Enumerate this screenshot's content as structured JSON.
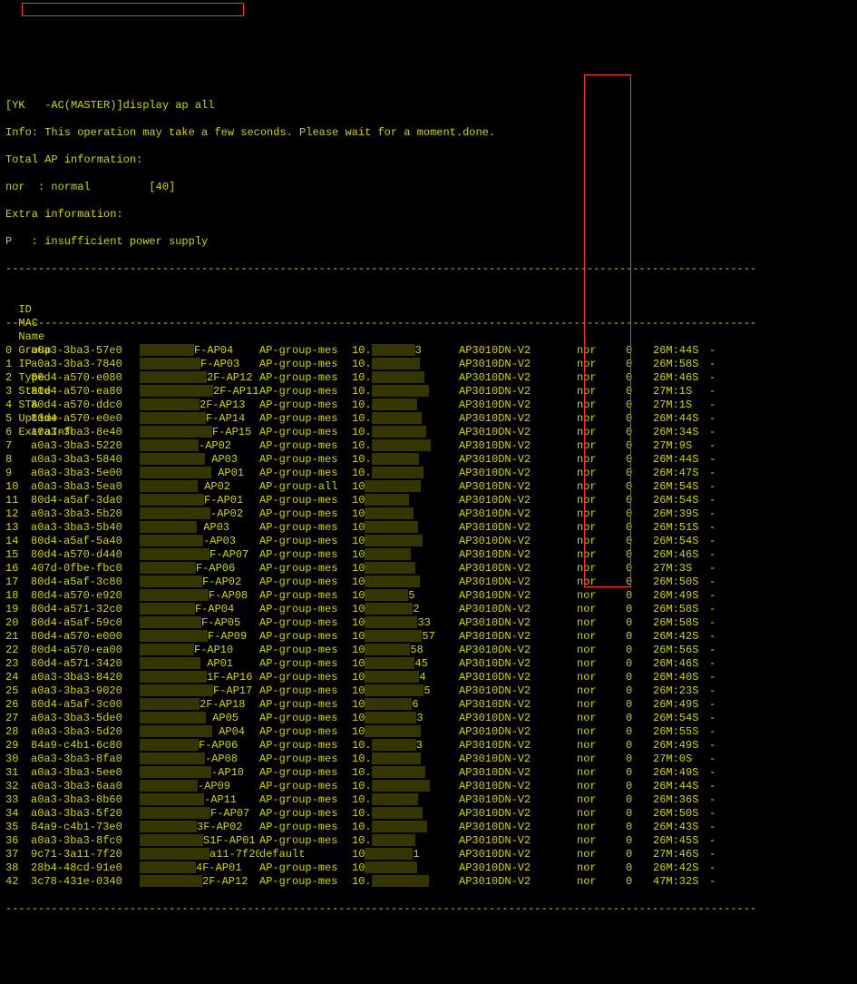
{
  "prompt_text": "[YK   -AC(MASTER)]display ap all",
  "info_line": "Info: This operation may take a few seconds. Please wait for a moment.done.",
  "total_line": "Total AP information:",
  "nor_line": "nor  : normal         [40]",
  "extra_line": "Extra information:",
  "p_line": "P   : insufficient power supply",
  "dashes": "-------------------------------------------------------------------------------------------------------------------",
  "headers": {
    "id": "ID",
    "mac": "MAC",
    "name": "Name",
    "group": "Group",
    "ip": "IP",
    "type": "Type",
    "state": "State",
    "sta": "STA",
    "uptime": "Uptime",
    "extra": "ExtraInfo"
  },
  "rows": [
    {
      "id": "0",
      "mac": "a0a3-3ba3-57e0",
      "name": "F-AP04",
      "group": "AP-group-mes",
      "ip": "10.",
      "ipr": "3",
      "type": "AP3010DN-V2",
      "state": "nor",
      "sta": "0",
      "uptime": "26M:44S",
      "extra": "-"
    },
    {
      "id": "1",
      "mac": "a0a3-3ba3-7840",
      "name": "F-AP03",
      "group": "AP-group-mes",
      "ip": "10.",
      "ipr": "",
      "type": "AP3010DN-V2",
      "state": "nor",
      "sta": "0",
      "uptime": "26M:58S",
      "extra": "-"
    },
    {
      "id": "2",
      "mac": "80d4-a570-e080",
      "name": "2F-AP12",
      "group": "AP-group-mes",
      "ip": "10.",
      "ipr": "",
      "type": "AP3010DN-V2",
      "state": "nor",
      "sta": "0",
      "uptime": "26M:46S",
      "extra": "-"
    },
    {
      "id": "3",
      "mac": "80d4-a570-ea80",
      "name": "2F-AP11",
      "group": "AP-group-mes",
      "ip": "10.",
      "ipr": "",
      "type": "AP3010DN-V2",
      "state": "nor",
      "sta": "0",
      "uptime": "27M:1S",
      "extra": "-"
    },
    {
      "id": "4",
      "mac": "80d4-a570-ddc0",
      "name": "2F-AP13",
      "group": "AP-group-mes",
      "ip": "10.",
      "ipr": "",
      "type": "AP3010DN-V2",
      "state": "nor",
      "sta": "0",
      "uptime": "27M:1S",
      "extra": "-"
    },
    {
      "id": "5",
      "mac": "80d4-a570-e0e0",
      "name": "F-AP14",
      "group": "AP-group-mes",
      "ip": "10.",
      "ipr": "",
      "type": "AP3010DN-V2",
      "state": "nor",
      "sta": "0",
      "uptime": "26M:44S",
      "extra": "-"
    },
    {
      "id": "6",
      "mac": "a0a3-3ba3-8e40",
      "name": "F-AP15",
      "group": "AP-group-mes",
      "ip": "10.",
      "ipr": "",
      "type": "AP3010DN-V2",
      "state": "nor",
      "sta": "0",
      "uptime": "26M:34S",
      "extra": "-"
    },
    {
      "id": "7",
      "mac": "a0a3-3ba3-5220",
      "name": "-AP02",
      "group": "AP-group-mes",
      "ip": "10.",
      "ipr": "",
      "type": "AP3010DN-V2",
      "state": "nor",
      "sta": "0",
      "uptime": "27M:9S",
      "extra": "-"
    },
    {
      "id": "8",
      "mac": "a0a3-3ba3-5840",
      "name": " AP03",
      "group": "AP-group-mes",
      "ip": "10.",
      "ipr": "",
      "type": "AP3010DN-V2",
      "state": "nor",
      "sta": "0",
      "uptime": "26M:44S",
      "extra": "-"
    },
    {
      "id": "9",
      "mac": "a0a3-3ba3-5e00",
      "name": " AP01",
      "group": "AP-group-mes",
      "ip": "10.",
      "ipr": "",
      "type": "AP3010DN-V2",
      "state": "nor",
      "sta": "0",
      "uptime": "26M:47S",
      "extra": "-"
    },
    {
      "id": "10",
      "mac": "a0a3-3ba3-5ea0",
      "name": " AP02",
      "group": "AP-group-all",
      "ip": "10",
      "ipr": "",
      "type": "AP3010DN-V2",
      "state": "nor",
      "sta": "0",
      "uptime": "26M:54S",
      "extra": "-"
    },
    {
      "id": "11",
      "mac": "80d4-a5af-3da0",
      "name": "F-AP01",
      "group": "AP-group-mes",
      "ip": "10",
      "ipr": "",
      "type": "AP3010DN-V2",
      "state": "nor",
      "sta": "0",
      "uptime": "26M:54S",
      "extra": "-"
    },
    {
      "id": "12",
      "mac": "a0a3-3ba3-5b20",
      "name": "-AP02",
      "group": "AP-group-mes",
      "ip": "10",
      "ipr": "",
      "type": "AP3010DN-V2",
      "state": "nor",
      "sta": "0",
      "uptime": "26M:39S",
      "extra": "-"
    },
    {
      "id": "13",
      "mac": "a0a3-3ba3-5b40",
      "name": " AP03",
      "group": "AP-group-mes",
      "ip": "10",
      "ipr": "",
      "type": "AP3010DN-V2",
      "state": "nor",
      "sta": "0",
      "uptime": "26M:51S",
      "extra": "-"
    },
    {
      "id": "14",
      "mac": "80d4-a5af-5a40",
      "name": "-AP03",
      "group": "AP-group-mes",
      "ip": "10",
      "ipr": "",
      "type": "AP3010DN-V2",
      "state": "nor",
      "sta": "0",
      "uptime": "26M:54S",
      "extra": "-"
    },
    {
      "id": "15",
      "mac": "80d4-a570-d440",
      "name": "F-AP07",
      "group": "AP-group-mes",
      "ip": "10",
      "ipr": "",
      "type": "AP3010DN-V2",
      "state": "nor",
      "sta": "0",
      "uptime": "26M:46S",
      "extra": "-"
    },
    {
      "id": "16",
      "mac": "407d-0fbe-fbc0",
      "name": "F-AP06",
      "group": "AP-group-mes",
      "ip": "10",
      "ipr": "",
      "type": "AP3010DN-V2",
      "state": "nor",
      "sta": "0",
      "uptime": "27M:3S",
      "extra": "-"
    },
    {
      "id": "17",
      "mac": "80d4-a5af-3c80",
      "name": "F-AP02",
      "group": "AP-group-mes",
      "ip": "10",
      "ipr": "",
      "type": "AP3010DN-V2",
      "state": "nor",
      "sta": "0",
      "uptime": "26M:50S",
      "extra": "-"
    },
    {
      "id": "18",
      "mac": "80d4-a570-e920",
      "name": "F-AP08",
      "group": "AP-group-mes",
      "ip": "10",
      "ipr": "5",
      "type": "AP3010DN-V2",
      "state": "nor",
      "sta": "0",
      "uptime": "26M:49S",
      "extra": "-"
    },
    {
      "id": "19",
      "mac": "80d4-a571-32c0",
      "name": "F-AP04",
      "group": "AP-group-mes",
      "ip": "10",
      "ipr": "2",
      "type": "AP3010DN-V2",
      "state": "nor",
      "sta": "0",
      "uptime": "26M:58S",
      "extra": "-"
    },
    {
      "id": "20",
      "mac": "80d4-a5af-59c0",
      "name": "F-AP05",
      "group": "AP-group-mes",
      "ip": "10",
      "ipr": "33",
      "type": "AP3010DN-V2",
      "state": "nor",
      "sta": "0",
      "uptime": "26M:58S",
      "extra": "-"
    },
    {
      "id": "21",
      "mac": "80d4-a570-e000",
      "name": "F-AP09",
      "group": "AP-group-mes",
      "ip": "10",
      "ipr": "57",
      "type": "AP3010DN-V2",
      "state": "nor",
      "sta": "0",
      "uptime": "26M:42S",
      "extra": "-"
    },
    {
      "id": "22",
      "mac": "80d4-a570-ea00",
      "name": "F-AP10",
      "group": "AP-group-mes",
      "ip": "10",
      "ipr": "58",
      "type": "AP3010DN-V2",
      "state": "nor",
      "sta": "0",
      "uptime": "26M:56S",
      "extra": "-"
    },
    {
      "id": "23",
      "mac": "80d4-a571-3420",
      "name": " AP01",
      "group": "AP-group-mes",
      "ip": "10",
      "ipr": "45",
      "type": "AP3010DN-V2",
      "state": "nor",
      "sta": "0",
      "uptime": "26M:46S",
      "extra": "-"
    },
    {
      "id": "24",
      "mac": "a0a3-3ba3-8420",
      "name": "1F-AP16",
      "group": "AP-group-mes",
      "ip": "10",
      "ipr": "4",
      "type": "AP3010DN-V2",
      "state": "nor",
      "sta": "0",
      "uptime": "26M:40S",
      "extra": "-"
    },
    {
      "id": "25",
      "mac": "a0a3-3ba3-9020",
      "name": "F-AP17",
      "group": "AP-group-mes",
      "ip": "10",
      "ipr": "5",
      "type": "AP3010DN-V2",
      "state": "nor",
      "sta": "0",
      "uptime": "26M:23S",
      "extra": "-"
    },
    {
      "id": "26",
      "mac": "80d4-a5af-3c00",
      "name": "2F-AP18",
      "group": "AP-group-mes",
      "ip": "10",
      "ipr": "6",
      "type": "AP3010DN-V2",
      "state": "nor",
      "sta": "0",
      "uptime": "26M:49S",
      "extra": "-"
    },
    {
      "id": "27",
      "mac": "a0a3-3ba3-5de0",
      "name": " AP05",
      "group": "AP-group-mes",
      "ip": "10",
      "ipr": "3",
      "type": "AP3010DN-V2",
      "state": "nor",
      "sta": "0",
      "uptime": "26M:54S",
      "extra": "-"
    },
    {
      "id": "28",
      "mac": "a0a3-3ba3-5d20",
      "name": " AP04",
      "group": "AP-group-mes",
      "ip": "10",
      "ipr": "",
      "type": "AP3010DN-V2",
      "state": "nor",
      "sta": "0",
      "uptime": "26M:55S",
      "extra": "-"
    },
    {
      "id": "29",
      "mac": "84a9-c4b1-6c80",
      "name": "F-AP06",
      "group": "AP-group-mes",
      "ip": "10.",
      "ipr": "3",
      "type": "AP3010DN-V2",
      "state": "nor",
      "sta": "0",
      "uptime": "26M:49S",
      "extra": "-"
    },
    {
      "id": "30",
      "mac": "a0a3-3ba3-8fa0",
      "name": "-AP08",
      "group": "AP-group-mes",
      "ip": "10.",
      "ipr": "",
      "type": "AP3010DN-V2",
      "state": "nor",
      "sta": "0",
      "uptime": "27M:0S",
      "extra": "-"
    },
    {
      "id": "31",
      "mac": "a0a3-3ba3-5ee0",
      "name": "-AP10",
      "group": "AP-group-mes",
      "ip": "10.",
      "ipr": "",
      "type": "AP3010DN-V2",
      "state": "nor",
      "sta": "0",
      "uptime": "26M:49S",
      "extra": "-"
    },
    {
      "id": "32",
      "mac": "a0a3-3ba3-6aa0",
      "name": "-AP09",
      "group": "AP-group-mes",
      "ip": "10.",
      "ipr": "",
      "type": "AP3010DN-V2",
      "state": "nor",
      "sta": "0",
      "uptime": "26M:44S",
      "extra": "-"
    },
    {
      "id": "33",
      "mac": "a0a3-3ba3-8b60",
      "name": "-AP11",
      "group": "AP-group-mes",
      "ip": "10.",
      "ipr": "",
      "type": "AP3010DN-V2",
      "state": "nor",
      "sta": "0",
      "uptime": "26M:36S",
      "extra": "-"
    },
    {
      "id": "34",
      "mac": "a0a3-3ba3-5f20",
      "name": "F-AP07",
      "group": "AP-group-mes",
      "ip": "10.",
      "ipr": "",
      "type": "AP3010DN-V2",
      "state": "nor",
      "sta": "0",
      "uptime": "26M:50S",
      "extra": "-"
    },
    {
      "id": "35",
      "mac": "84a9-c4b1-73e0",
      "name": "3F-AP02",
      "group": "AP-group-mes",
      "ip": "10.",
      "ipr": "",
      "type": "AP3010DN-V2",
      "state": "nor",
      "sta": "0",
      "uptime": "26M:43S",
      "extra": "-"
    },
    {
      "id": "36",
      "mac": "a0a3-3ba3-8fc0",
      "name": "S1F-AP01",
      "group": "AP-group-mes",
      "ip": "10.",
      "ipr": "",
      "type": "AP3010DN-V2",
      "state": "nor",
      "sta": "0",
      "uptime": "26M:45S",
      "extra": "-"
    },
    {
      "id": "37",
      "mac": "9c71-3a11-7f20",
      "name": "a11-7f20",
      "group": "default",
      "ip": "10",
      "ipr": "1",
      "type": "AP3010DN-V2",
      "state": "nor",
      "sta": "0",
      "uptime": "27M:46S",
      "extra": "-"
    },
    {
      "id": "38",
      "mac": "28b4-48cd-91e0",
      "name": "4F-AP01",
      "group": "AP-group-mes",
      "ip": "10",
      "ipr": "",
      "type": "AP3010DN-V2",
      "state": "nor",
      "sta": "0",
      "uptime": "26M:42S",
      "extra": "-"
    },
    {
      "id": "42",
      "mac": "3c78-431e-0340",
      "name": "2F-AP12",
      "group": "AP-group-mes",
      "ip": "10.",
      "ipr": "",
      "type": "AP3010DN-V2",
      "state": "nor",
      "sta": "0",
      "uptime": "47M:32S",
      "extra": "-"
    }
  ]
}
